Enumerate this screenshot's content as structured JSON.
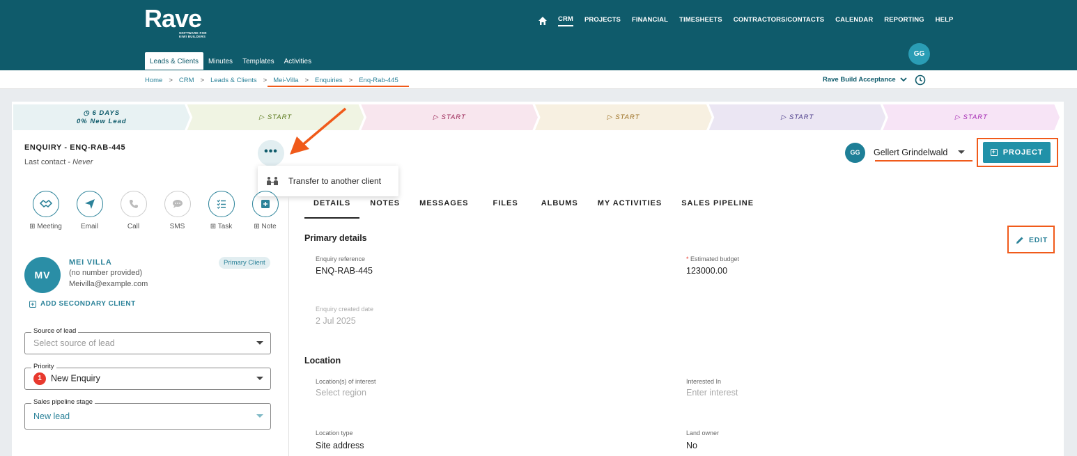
{
  "app": {
    "logo": "Rave",
    "logo_tagline_1": "SOFTWARE FOR",
    "logo_tagline_2": "KIWI BUILDERS"
  },
  "nav": {
    "items": [
      "CRM",
      "PROJECTS",
      "FINANCIAL",
      "TIMESHEETS",
      "CONTRACTORS/CONTACTS",
      "CALENDAR",
      "REPORTING",
      "HELP"
    ],
    "active": "CRM"
  },
  "subtabs": [
    "Leads & Clients",
    "Minutes",
    "Templates",
    "Activities"
  ],
  "user": {
    "initials": "GG"
  },
  "breadcrumb": [
    "Home",
    "CRM",
    "Leads & Clients",
    "Mei-Villa",
    "Enquiries",
    "Enq-Rab-445"
  ],
  "project_select": "Rave Build Acceptance",
  "pipeline": {
    "first_days": "6 DAYS",
    "first_status": "0% New Lead",
    "start_label": "START",
    "colors": [
      "#e8f2f3",
      "#f0f4e3",
      "#f8e6ee",
      "#f7f0e1",
      "#ebe6f3",
      "#f7e4f6"
    ],
    "text_colors": [
      "#0f5b6b",
      "#5c7a1e",
      "#9a2454",
      "#9a6d1e",
      "#4b3b8a",
      "#a52ab3"
    ]
  },
  "enquiry": {
    "title": "ENQUIRY - ENQ-RAB-445",
    "last_contact_label": "Last contact - ",
    "last_contact_value": "Never"
  },
  "more_menu": {
    "button": "•••",
    "transfer": "Transfer to another client"
  },
  "actions": [
    {
      "label": "⊞ Meeting"
    },
    {
      "label": "Email"
    },
    {
      "label": "Call"
    },
    {
      "label": "SMS"
    },
    {
      "label": "⊞ Task"
    },
    {
      "label": "⊞ Note"
    }
  ],
  "client": {
    "initials": "MV",
    "name": "MEI VILLA",
    "phone": "(no number provided)",
    "email": "Meivilla@example.com",
    "badge": "Primary Client",
    "add_secondary": "ADD SECONDARY CLIENT"
  },
  "fields": {
    "source_label": "Source of lead",
    "source_placeholder": "Select source of lead",
    "priority_label": "Priority",
    "priority_badge": "1",
    "priority_value": "New Enquiry",
    "stage_label": "Sales pipeline stage",
    "stage_value": "New lead"
  },
  "owner": {
    "initials": "GG",
    "name": "Gellert Grindelwald"
  },
  "project_button": "PROJECT",
  "tabs": [
    "DETAILS",
    "NOTES",
    "MESSAGES",
    "FILES",
    "ALBUMS",
    "MY ACTIVITIES",
    "SALES PIPELINE"
  ],
  "edit_button": "EDIT",
  "details": {
    "primary_heading": "Primary details",
    "enquiry_ref_label": "Enquiry reference",
    "enquiry_ref_value": "ENQ-RAB-445",
    "budget_req": "*",
    "budget_label": " Estimated budget",
    "budget_value": "123000.00",
    "created_label": "Enquiry created date",
    "created_value": "2 Jul 2025",
    "location_heading": "Location",
    "locations_label": "Location(s) of interest",
    "locations_placeholder": "Select region",
    "interested_label": "Interested In",
    "interested_placeholder": "Enter interest",
    "loc_type_label": "Location type",
    "loc_type_value": "Site address",
    "land_owner_label": "Land owner",
    "land_owner_value": "No"
  }
}
